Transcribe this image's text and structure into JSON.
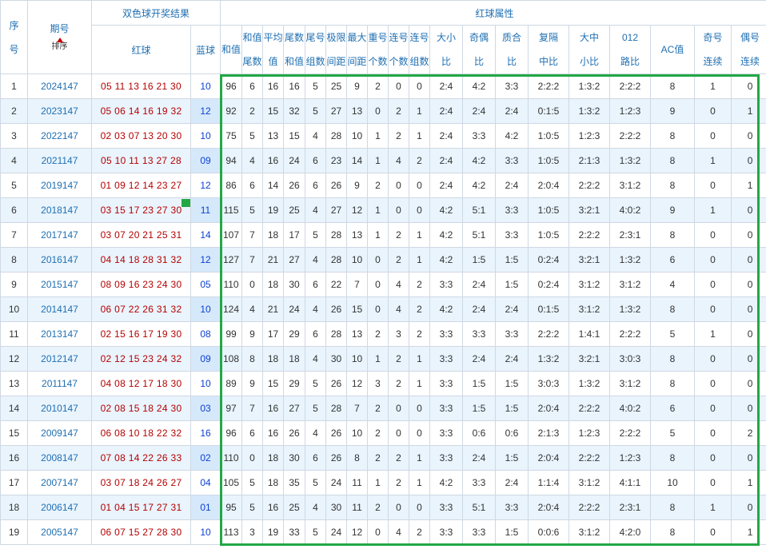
{
  "headers": {
    "seq": [
      "序",
      "号"
    ],
    "period": "期号",
    "sort": "排序",
    "draw_group": "双色球开奖结果",
    "red": "红球",
    "blue": "蓝球",
    "attr_group": "红球属性",
    "cols": [
      [
        "和值"
      ],
      [
        "和值",
        "尾数"
      ],
      [
        "平均",
        "值"
      ],
      [
        "尾数",
        "和值"
      ],
      [
        "尾号",
        "组数"
      ],
      [
        "极限",
        "间距"
      ],
      [
        "最大",
        "间距"
      ],
      [
        "重号",
        "个数"
      ],
      [
        "连号",
        "个数"
      ],
      [
        "连号",
        "组数"
      ],
      [
        "大小",
        "比"
      ],
      [
        "奇偶",
        "比"
      ],
      [
        "质合",
        "比"
      ],
      [
        "复隔",
        "中比"
      ],
      [
        "大中",
        "小比"
      ],
      [
        "012",
        "路比"
      ],
      [
        "AC值"
      ],
      [
        "奇号",
        "连续"
      ],
      [
        "偶号",
        "连续"
      ]
    ]
  },
  "rows": [
    [
      "1",
      "2024147",
      "05 11 13 16 21 30",
      "10",
      "96",
      "6",
      "16",
      "16",
      "5",
      "25",
      "9",
      "2",
      "0",
      "0",
      "2:4",
      "4:2",
      "3:3",
      "2:2:2",
      "1:3:2",
      "2:2:2",
      "8",
      "1",
      "0"
    ],
    [
      "2",
      "2023147",
      "05 06 14 16 19 32",
      "12",
      "92",
      "2",
      "15",
      "32",
      "5",
      "27",
      "13",
      "0",
      "2",
      "1",
      "2:4",
      "2:4",
      "2:4",
      "0:1:5",
      "1:3:2",
      "1:2:3",
      "9",
      "0",
      "1"
    ],
    [
      "3",
      "2022147",
      "02 03 07 13 20 30",
      "10",
      "75",
      "5",
      "13",
      "15",
      "4",
      "28",
      "10",
      "1",
      "2",
      "1",
      "2:4",
      "3:3",
      "4:2",
      "1:0:5",
      "1:2:3",
      "2:2:2",
      "8",
      "0",
      "0"
    ],
    [
      "4",
      "2021147",
      "05 10 11 13 27 28",
      "09",
      "94",
      "4",
      "16",
      "24",
      "6",
      "23",
      "14",
      "1",
      "4",
      "2",
      "2:4",
      "4:2",
      "3:3",
      "1:0:5",
      "2:1:3",
      "1:3:2",
      "8",
      "1",
      "0"
    ],
    [
      "5",
      "2019147",
      "01 09 12 14 23 27",
      "12",
      "86",
      "6",
      "14",
      "26",
      "6",
      "26",
      "9",
      "2",
      "0",
      "0",
      "2:4",
      "4:2",
      "2:4",
      "2:0:4",
      "2:2:2",
      "3:1:2",
      "8",
      "0",
      "1"
    ],
    [
      "6",
      "2018147",
      "03 15 17 23 27 30",
      "11",
      "115",
      "5",
      "19",
      "25",
      "4",
      "27",
      "12",
      "1",
      "0",
      "0",
      "4:2",
      "5:1",
      "3:3",
      "1:0:5",
      "3:2:1",
      "4:0:2",
      "9",
      "1",
      "0"
    ],
    [
      "7",
      "2017147",
      "03 07 20 21 25 31",
      "14",
      "107",
      "7",
      "18",
      "17",
      "5",
      "28",
      "13",
      "1",
      "2",
      "1",
      "4:2",
      "5:1",
      "3:3",
      "1:0:5",
      "2:2:2",
      "2:3:1",
      "8",
      "0",
      "0"
    ],
    [
      "8",
      "2016147",
      "04 14 18 28 31 32",
      "12",
      "127",
      "7",
      "21",
      "27",
      "4",
      "28",
      "10",
      "0",
      "2",
      "1",
      "4:2",
      "1:5",
      "1:5",
      "0:2:4",
      "3:2:1",
      "1:3:2",
      "6",
      "0",
      "0"
    ],
    [
      "9",
      "2015147",
      "08 09 16 23 24 30",
      "05",
      "110",
      "0",
      "18",
      "30",
      "6",
      "22",
      "7",
      "0",
      "4",
      "2",
      "3:3",
      "2:4",
      "1:5",
      "0:2:4",
      "3:1:2",
      "3:1:2",
      "4",
      "0",
      "0"
    ],
    [
      "10",
      "2014147",
      "06 07 22 26 31 32",
      "10",
      "124",
      "4",
      "21",
      "24",
      "4",
      "26",
      "15",
      "0",
      "4",
      "2",
      "4:2",
      "2:4",
      "2:4",
      "0:1:5",
      "3:1:2",
      "1:3:2",
      "8",
      "0",
      "0"
    ],
    [
      "11",
      "2013147",
      "02 15 16 17 19 30",
      "08",
      "99",
      "9",
      "17",
      "29",
      "6",
      "28",
      "13",
      "2",
      "3",
      "2",
      "3:3",
      "3:3",
      "3:3",
      "2:2:2",
      "1:4:1",
      "2:2:2",
      "5",
      "1",
      "0"
    ],
    [
      "12",
      "2012147",
      "02 12 15 23 24 32",
      "09",
      "108",
      "8",
      "18",
      "18",
      "4",
      "30",
      "10",
      "1",
      "2",
      "1",
      "3:3",
      "2:4",
      "2:4",
      "1:3:2",
      "3:2:1",
      "3:0:3",
      "8",
      "0",
      "0"
    ],
    [
      "13",
      "2011147",
      "04 08 12 17 18 30",
      "10",
      "89",
      "9",
      "15",
      "29",
      "5",
      "26",
      "12",
      "3",
      "2",
      "1",
      "3:3",
      "1:5",
      "1:5",
      "3:0:3",
      "1:3:2",
      "3:1:2",
      "8",
      "0",
      "0"
    ],
    [
      "14",
      "2010147",
      "02 08 15 18 24 30",
      "03",
      "97",
      "7",
      "16",
      "27",
      "5",
      "28",
      "7",
      "2",
      "0",
      "0",
      "3:3",
      "1:5",
      "1:5",
      "2:0:4",
      "2:2:2",
      "4:0:2",
      "6",
      "0",
      "0"
    ],
    [
      "15",
      "2009147",
      "06 08 10 18 22 32",
      "16",
      "96",
      "6",
      "16",
      "26",
      "4",
      "26",
      "10",
      "2",
      "0",
      "0",
      "3:3",
      "0:6",
      "0:6",
      "2:1:3",
      "1:2:3",
      "2:2:2",
      "5",
      "0",
      "2"
    ],
    [
      "16",
      "2008147",
      "07 08 14 22 26 33",
      "02",
      "110",
      "0",
      "18",
      "30",
      "6",
      "26",
      "8",
      "2",
      "2",
      "1",
      "3:3",
      "2:4",
      "1:5",
      "2:0:4",
      "2:2:2",
      "1:2:3",
      "8",
      "0",
      "0"
    ],
    [
      "17",
      "2007147",
      "03 07 18 24 26 27",
      "04",
      "105",
      "5",
      "18",
      "35",
      "5",
      "24",
      "11",
      "1",
      "2",
      "1",
      "4:2",
      "3:3",
      "2:4",
      "1:1:4",
      "3:1:2",
      "4:1:1",
      "10",
      "0",
      "1"
    ],
    [
      "18",
      "2006147",
      "01 04 15 17 27 31",
      "01",
      "95",
      "5",
      "16",
      "25",
      "4",
      "30",
      "11",
      "2",
      "0",
      "0",
      "3:3",
      "5:1",
      "3:3",
      "2:0:4",
      "2:2:2",
      "2:3:1",
      "8",
      "1",
      "0"
    ],
    [
      "19",
      "2005147",
      "06 07 15 27 28 30",
      "10",
      "113",
      "3",
      "19",
      "33",
      "5",
      "24",
      "12",
      "0",
      "4",
      "2",
      "3:3",
      "3:3",
      "1:5",
      "0:0:6",
      "3:1:2",
      "4:2:0",
      "8",
      "0",
      "1"
    ]
  ],
  "colors": {
    "highlight": "#22a845",
    "red_ball": "#b50000",
    "blue_ball": "#0b3fd6",
    "header_text": "#1f6fb2"
  }
}
